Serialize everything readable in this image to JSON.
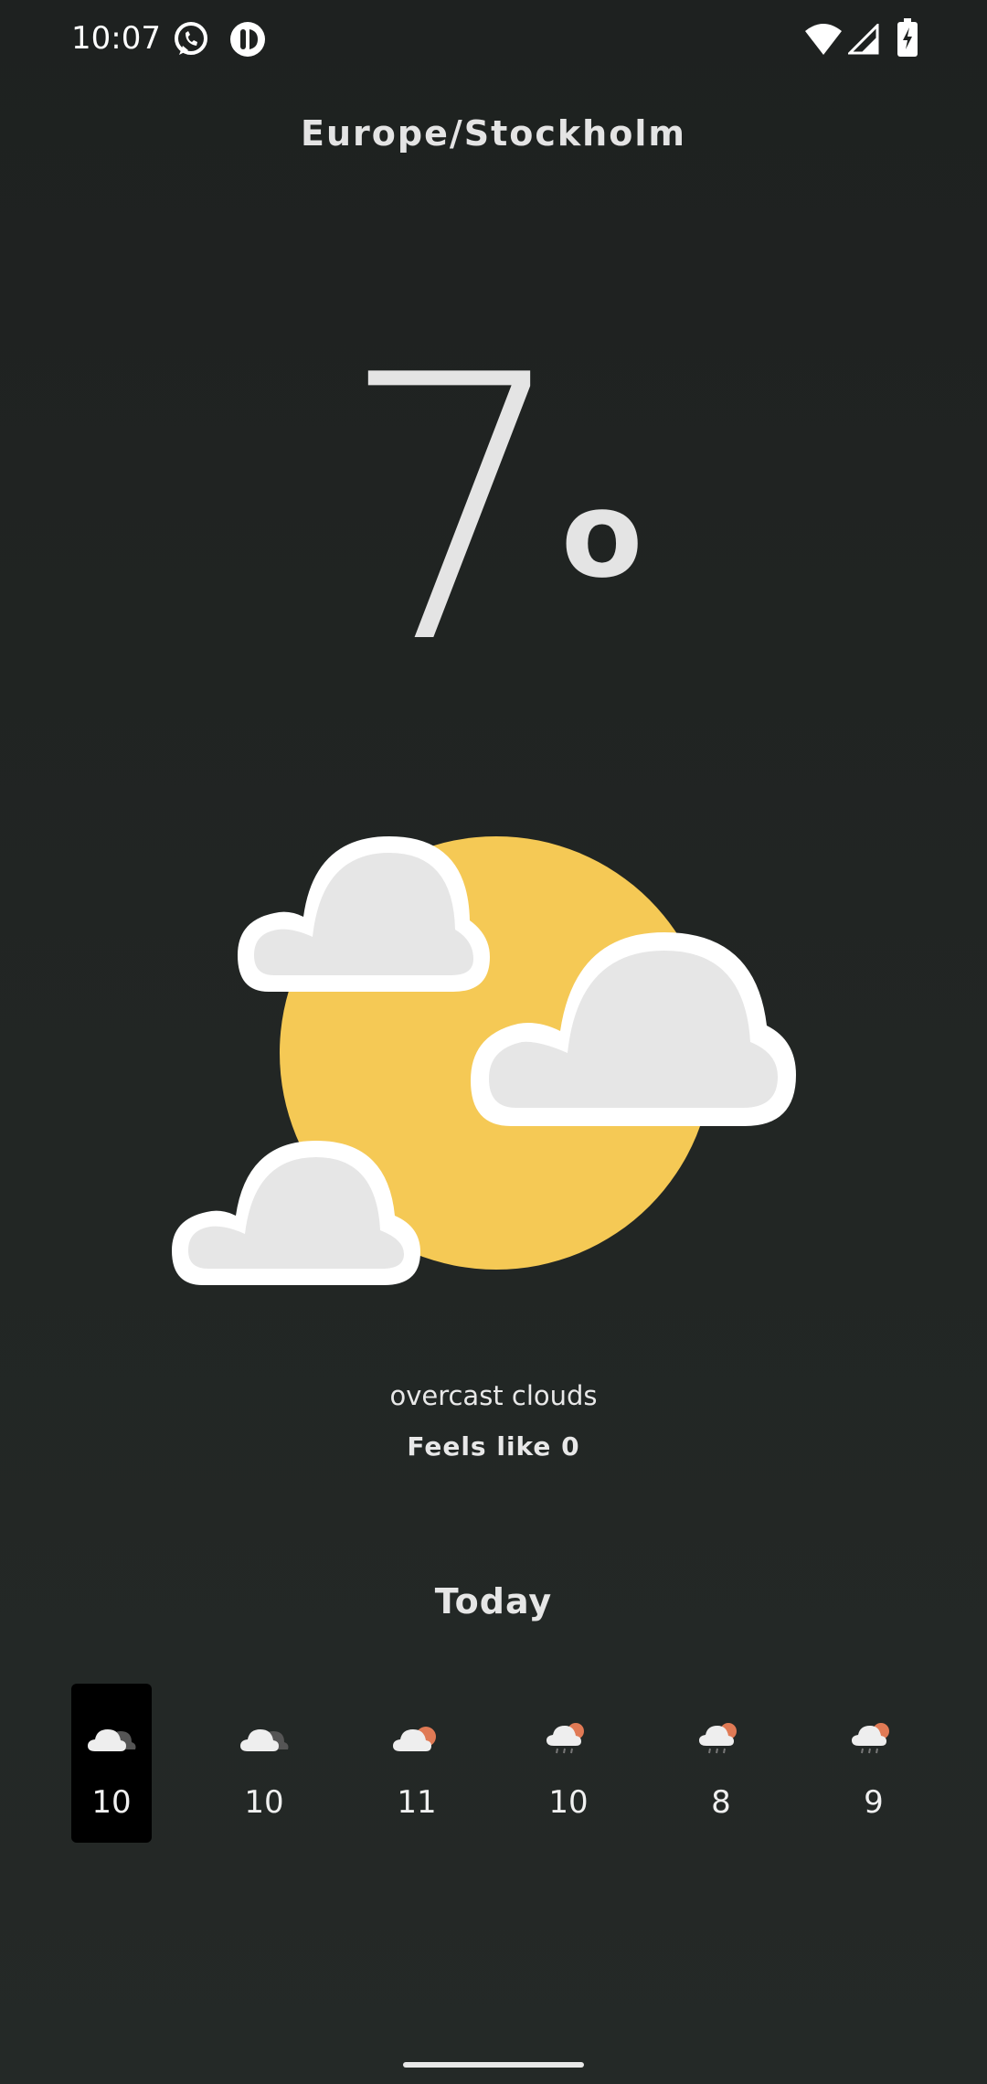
{
  "status_bar": {
    "time": "10:07",
    "left_icons": [
      "whatsapp-icon",
      "app-notification-icon"
    ],
    "right_icons": [
      "wifi-icon",
      "cell-signal-icon",
      "battery-charging-icon"
    ]
  },
  "location": "Europe/Stockholm",
  "current": {
    "temperature": "7",
    "unit": "o",
    "icon": "partly-cloudy-sun-icon",
    "description": "overcast clouds",
    "feels_like": "Feels like 0"
  },
  "today": {
    "label": "Today",
    "hours": [
      {
        "temp": "10",
        "icon": "overcast-clouds-icon",
        "selected": true
      },
      {
        "temp": "10",
        "icon": "overcast-clouds-icon",
        "selected": false
      },
      {
        "temp": "11",
        "icon": "cloud-sun-icon",
        "selected": false
      },
      {
        "temp": "10",
        "icon": "cloud-sun-rain-icon",
        "selected": false
      },
      {
        "temp": "8",
        "icon": "cloud-sun-rain-icon",
        "selected": false
      },
      {
        "temp": "9",
        "icon": "cloud-sun-rain-icon",
        "selected": false
      }
    ]
  },
  "colors": {
    "background": "#222624",
    "sun": "#f5c955",
    "cloud": "#e6e6e6",
    "cloud_outline": "#ffffff",
    "small_sun": "#e07a55",
    "selected_bg": "#000000"
  }
}
